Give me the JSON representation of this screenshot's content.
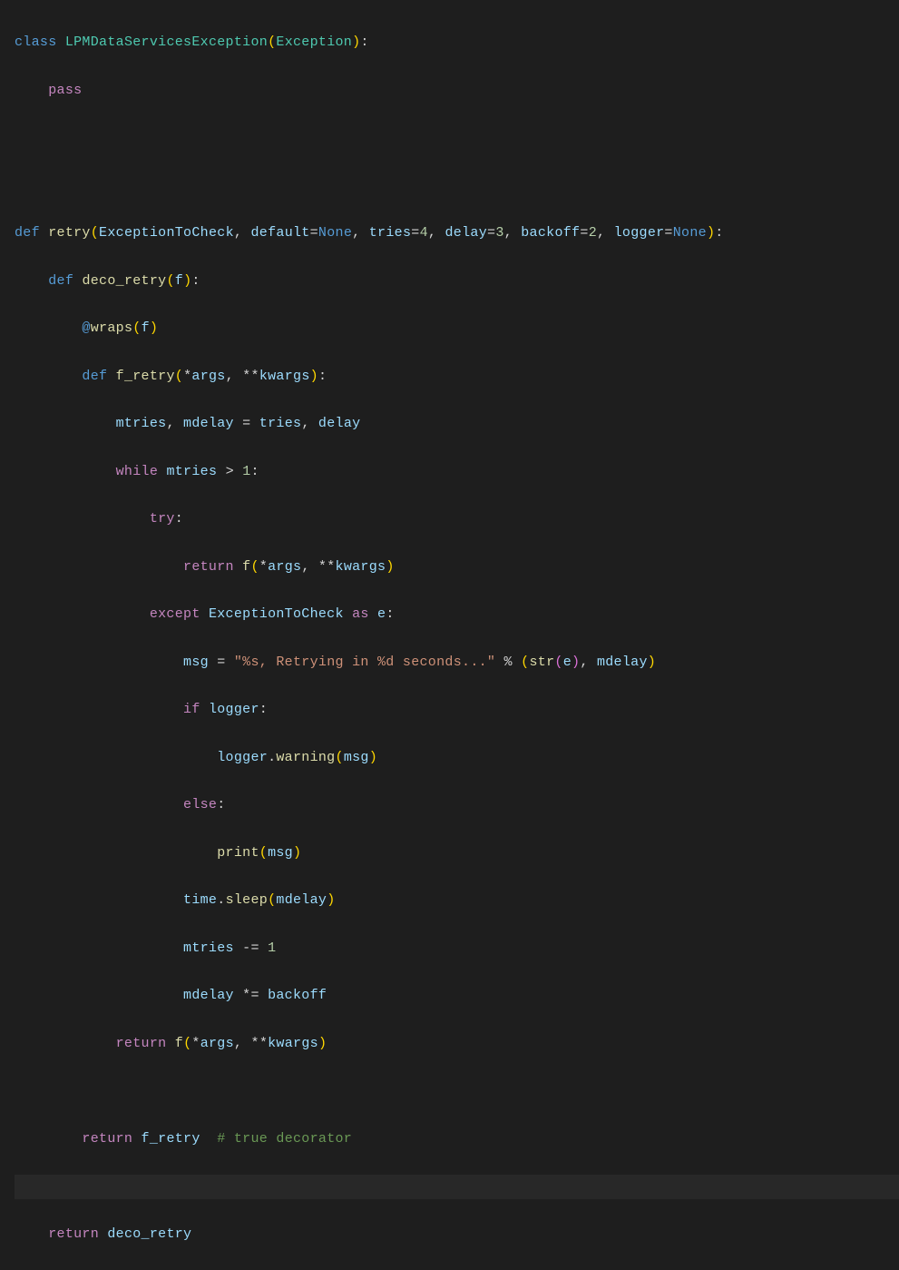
{
  "code": {
    "line1": {
      "kw_class": "class",
      "class_name": "LPMDataServicesException",
      "base": "Exception"
    },
    "line2": {
      "kw_pass": "pass"
    },
    "line5": {
      "kw_def": "def",
      "func_name": "retry",
      "param1": "ExceptionToCheck",
      "param2": "default",
      "val2": "None",
      "param3": "tries",
      "val3": "4",
      "param4": "delay",
      "val4": "3",
      "param5": "backoff",
      "val5": "2",
      "param6": "logger",
      "val6": "None"
    },
    "line6": {
      "kw_def": "def",
      "func_name": "deco_retry",
      "param": "f"
    },
    "line7": {
      "decorator": "@wraps",
      "param": "f"
    },
    "line8": {
      "kw_def": "def",
      "func_name": "f_retry",
      "args": "args",
      "kwargs": "kwargs"
    },
    "line9": {
      "var1": "mtries",
      "var2": "mdelay",
      "var3": "tries",
      "var4": "delay"
    },
    "line10": {
      "kw_while": "while",
      "var": "mtries",
      "num": "1"
    },
    "line11": {
      "kw_try": "try"
    },
    "line12": {
      "kw_return": "return",
      "func": "f",
      "args": "args",
      "kwargs": "kwargs"
    },
    "line13": {
      "kw_except": "except",
      "exc": "ExceptionToCheck",
      "kw_as": "as",
      "var": "e"
    },
    "line14": {
      "var": "msg",
      "string": "\"%s, Retrying in %d seconds...\"",
      "func1": "str",
      "arg1": "e",
      "arg2": "mdelay"
    },
    "line15": {
      "kw_if": "if",
      "var": "logger"
    },
    "line16": {
      "obj": "logger",
      "method": "warning",
      "arg": "msg"
    },
    "line17": {
      "kw_else": "else"
    },
    "line18": {
      "func": "print",
      "arg": "msg"
    },
    "line19": {
      "obj": "time",
      "method": "sleep",
      "arg": "mdelay"
    },
    "line20": {
      "var": "mtries",
      "num": "1"
    },
    "line21": {
      "var1": "mdelay",
      "var2": "backoff"
    },
    "line22": {
      "kw_return": "return",
      "func": "f",
      "args": "args",
      "kwargs": "kwargs"
    },
    "line24": {
      "kw_return": "return",
      "var": "f_retry",
      "comment": "# true decorator"
    },
    "line26": {
      "kw_return": "return",
      "var": "deco_retry"
    }
  }
}
